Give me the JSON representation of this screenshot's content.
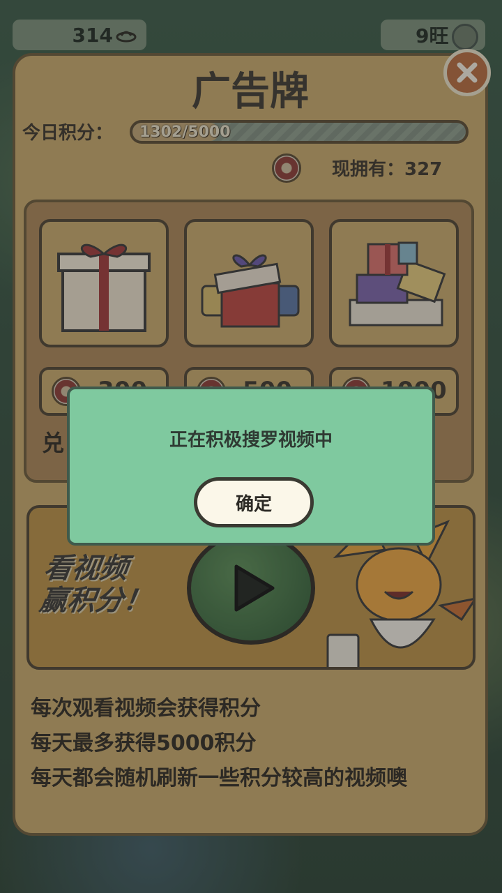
{
  "top_bar": {
    "coins": "314",
    "wang": "9旺"
  },
  "panel": {
    "title": "广告牌",
    "score_label": "今日积分：",
    "progress_text": "1302/5000",
    "progress": {
      "current": 1302,
      "max": 5000
    },
    "owned_text": "现拥有：327"
  },
  "shop": {
    "items": [
      {
        "price": "300"
      },
      {
        "price": "500"
      },
      {
        "price": "1000"
      }
    ],
    "exchange_label": "兑"
  },
  "video": {
    "slogan_line1": "看视频",
    "slogan_line2": "赢积分！"
  },
  "info": [
    "每次观看视频会获得积分",
    "每天最多获得5000积分",
    "每天都会随机刷新一些积分较高的视频噢"
  ],
  "dialog": {
    "message": "正在积极搜罗视频中",
    "confirm_label": "确定"
  },
  "colors": {
    "panel": "#c7a86b",
    "dialog": "#7fc99f",
    "accent": "#b56a3e"
  }
}
